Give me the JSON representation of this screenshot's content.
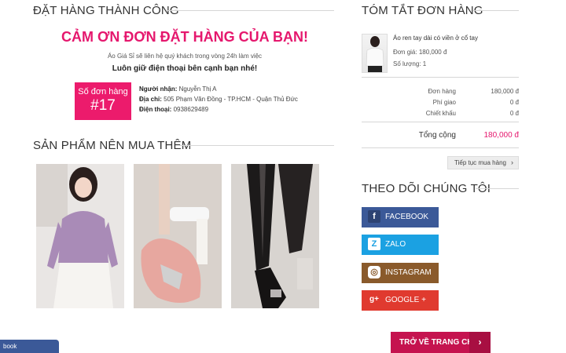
{
  "left": {
    "title": "ĐẶT HÀNG THÀNH CÔNG",
    "thanks": "CẢM ƠN ĐƠN ĐẶT HÀNG CỦA BẠN!",
    "contact_note": "Áo Giá Sỉ sẽ liên hệ quý khách trong vòng 24h làm việc",
    "keep_phone": "Luôn giữ điện thoại bên cạnh bạn nhé!",
    "order_label": "Số đơn hàng",
    "order_number": "#17",
    "recipient_label": "Người nhận:",
    "recipient_value": "Nguyễn Thị A",
    "address_label": "Địa chỉ:",
    "address_value": "505 Phạm Văn Đồng - TP.HCM - Quận Thủ Đức",
    "phone_label": "Điện thoại:",
    "phone_value": "0938629489"
  },
  "recommend": {
    "title": "SẢN PHẨM NÊN MUA THÊM"
  },
  "summary": {
    "title": "TÓM TẮT ĐƠN HÀNG",
    "product_name": "Áo ren tay dài có viền ở cổ tay",
    "unit_price_label": "Đơn giá:",
    "unit_price_value": "180,000 đ",
    "qty_label": "Số lượng:",
    "qty_value": "1",
    "order_label": "Đơn hàng",
    "order_value": "180,000 đ",
    "shipping_label": "Phí giao",
    "shipping_value": "0 đ",
    "discount_label": "Chiết khấu",
    "discount_value": "0 đ",
    "total_label": "Tổng cộng",
    "total_value": "180,000 đ",
    "continue_label": "Tiếp tục mua hàng"
  },
  "follow": {
    "title": "THEO DÕI CHÚNG TÔI",
    "facebook": "FACEBOOK",
    "zalo": "ZALO",
    "instagram": "INSTAGRAM",
    "google": "GOOGLE +"
  },
  "home_button": "TRỞ VỀ TRANG CHỦ",
  "fb_widget": "book",
  "colors": {
    "accent": "#e5176d",
    "facebook": "#3b5998",
    "zalo": "#1ba1e2",
    "instagram": "#8a5a2b",
    "google": "#e03a2f"
  },
  "icons": [
    "facebook-icon",
    "zalo-icon",
    "instagram-icon",
    "google-plus-icon",
    "chevron-right-icon"
  ]
}
